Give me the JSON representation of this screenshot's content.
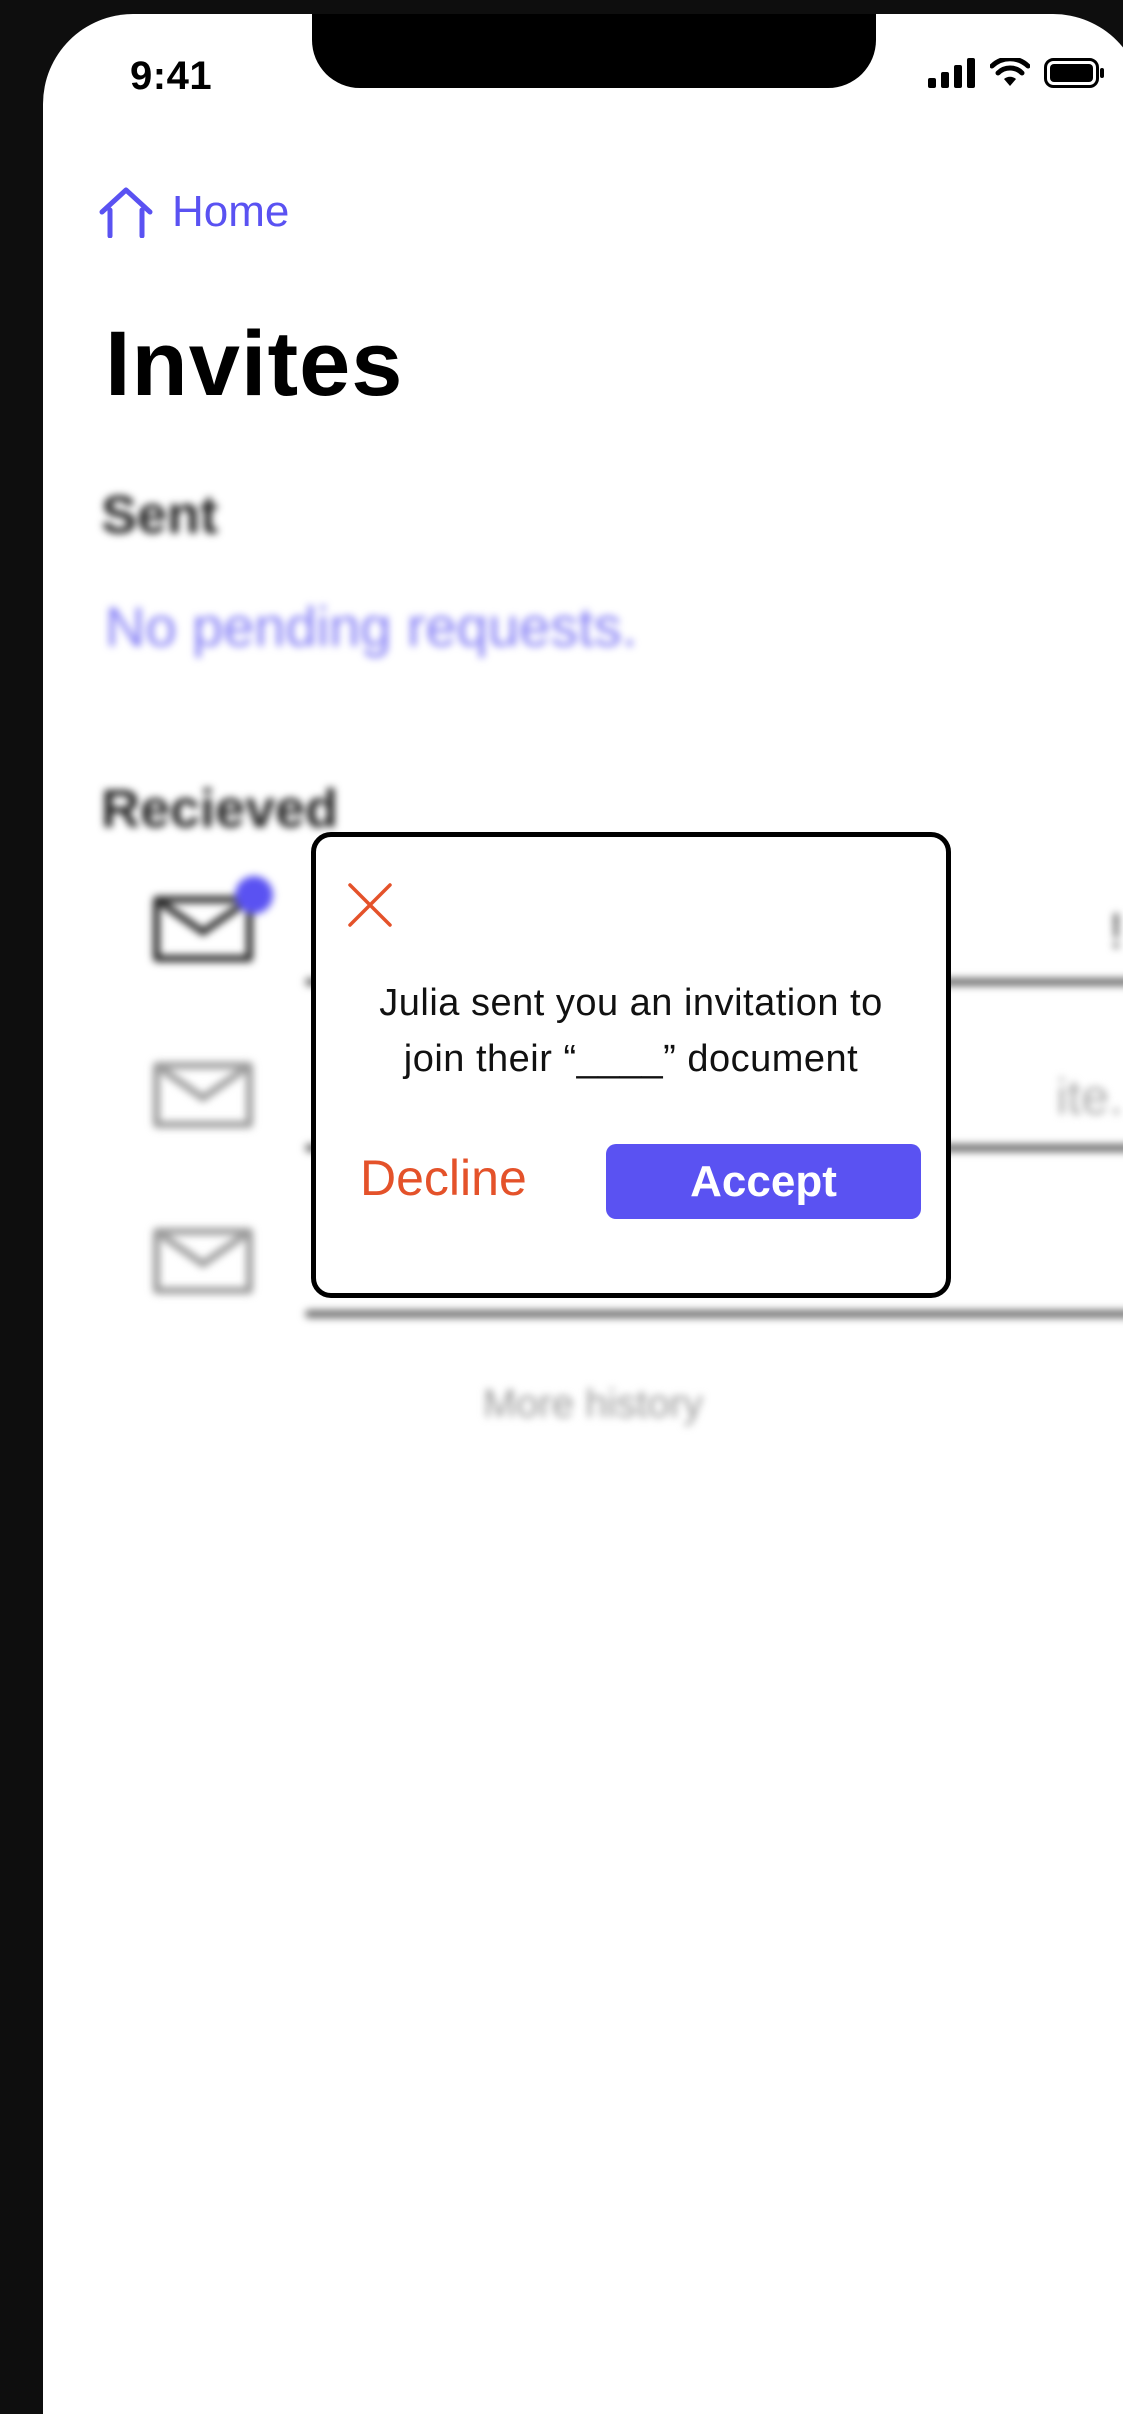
{
  "status_bar": {
    "time": "9:41",
    "icons": [
      "cellular-signal-icon",
      "wifi-icon",
      "battery-icon"
    ]
  },
  "nav": {
    "home_label": "Home",
    "home_icon": "home-icon"
  },
  "page": {
    "title": "Invites"
  },
  "sent": {
    "heading": "Sent",
    "empty_message": "No pending requests."
  },
  "received": {
    "heading": "Recieved",
    "rows": [
      {
        "icon": "envelope-icon",
        "has_badge": true,
        "trailing_text": "!"
      },
      {
        "icon": "envelope-icon",
        "has_badge": false,
        "trailing_text": "ite."
      },
      {
        "icon": "envelope-icon",
        "has_badge": false,
        "trailing_text": ""
      }
    ],
    "more_history": "More history"
  },
  "dialog": {
    "close_icon": "close-icon",
    "message": "Julia sent you an invitation to join their “____” document",
    "decline_label": "Decline",
    "accept_label": "Accept"
  },
  "colors": {
    "accent": "#5a52f2",
    "decline": "#e4522a",
    "background": "#ffffff",
    "frame": "#0e0e0e"
  }
}
